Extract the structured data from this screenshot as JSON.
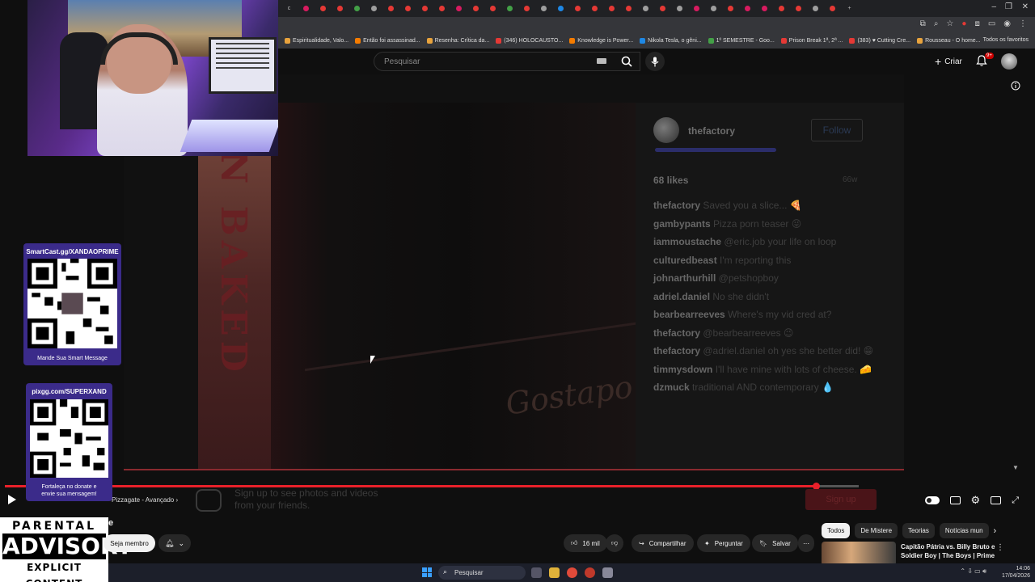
{
  "browser": {
    "bookmarks": [
      "Espiritualidade, Valo...",
      "Então foi assassinad...",
      "Resenha: Crítica da...",
      "(346) HOLOCAUSTO...",
      "Knowledge is Power...",
      "Nikola Tesla, o gêni...",
      "1º SEMESTRE - Goo...",
      "Prison Break 1ª, 2ª ...",
      "(383) ♥ Cutting Cre...",
      "Rousseau - O home..."
    ],
    "all_favorites": "Todos os favoritos"
  },
  "youtube": {
    "search_placeholder": "Pesquisar",
    "create_label": "Criar",
    "notif_badge": "9+",
    "chapter_label": "Pizzagate - Avançado",
    "channel_partial": "e",
    "member_button": "Seja membro",
    "likes": "16 mil",
    "share": "Compartilhar",
    "ask": "Perguntar",
    "save": "Salvar",
    "chips": [
      "Todos",
      "De Mistere",
      "Teorias",
      "Notícias mun"
    ],
    "rec_title": "Capitão Pátria vs. Billy Bruto e Soldier Boy | The Boys | Prime ...",
    "progress_fraction": 0.95
  },
  "instagram": {
    "username": "thefactory",
    "follow": "Follow",
    "likes": "68 likes",
    "time": "66w",
    "comments": [
      {
        "user": "thefactory",
        "text": "Saved you a slice... 🍕"
      },
      {
        "user": "gambypants",
        "text": "Pizza porn teaser 😜"
      },
      {
        "user": "iammoustache",
        "text": "@eric.job your life on loop"
      },
      {
        "user": "culturedbeast",
        "text": "I'm reporting this"
      },
      {
        "user": "johnarthurhill",
        "text": "@petshopboy"
      },
      {
        "user": "adriel.daniel",
        "text": "No she didn't"
      },
      {
        "user": "bearbearreeves",
        "text": "Where's my vid cred at?"
      },
      {
        "user": "thefactory",
        "text": "@bearbearreeves 😉"
      },
      {
        "user": "thefactory",
        "text": "@adriel.daniel oh yes she better did! 😁"
      },
      {
        "user": "timmysdown",
        "text": "I'll have mine with lots of cheese. 🧀"
      },
      {
        "user": "dzmuck",
        "text": "traditional AND contemporary 💧"
      }
    ],
    "signup_text_1": "Sign up to see photos and videos",
    "signup_text_2": "from your friends.",
    "signup_button": "Sign up"
  },
  "video_text": {
    "box_text": "N BAKED",
    "script_text": "Gostapo"
  },
  "overlays": {
    "qr1_title": "SmartCast.gg/XANDAOPRIME",
    "qr1_footer": "Mande Sua Smart Message",
    "qr2_title": "pixgg.com/SUPERXAND",
    "qr2_footer_1": "Fortaleça no donate e",
    "qr2_footer_2": "envie sua mensagem!",
    "pa_top": "PARENTAL",
    "pa_mid": "ADVISORY",
    "pa_bot": "EXPLICIT CONTENT"
  },
  "taskbar": {
    "search": "Pesquisar",
    "time": "14:06",
    "date": "17/04/2026"
  }
}
